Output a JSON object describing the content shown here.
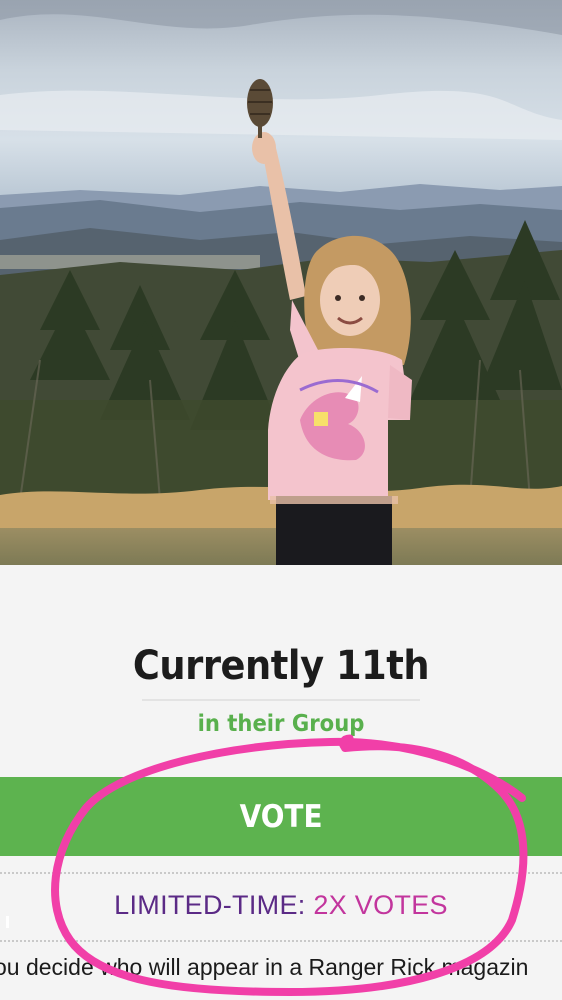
{
  "rank": {
    "title": "Currently 11th",
    "subtitle": "in their Group"
  },
  "vote": {
    "label": "VOTE"
  },
  "promo": {
    "label_prefix": "LIMITED-TIME:",
    "label_highlight": "2X VOTES",
    "note": "ou decide who will appear in a Ranger Rick magazin"
  },
  "colors": {
    "accent_green": "#5db34f",
    "subtitle_green": "#59b04d",
    "promo_purple": "#5b2a86",
    "promo_magenta": "#c2359d",
    "annotation_pink": "#f13fa8"
  }
}
